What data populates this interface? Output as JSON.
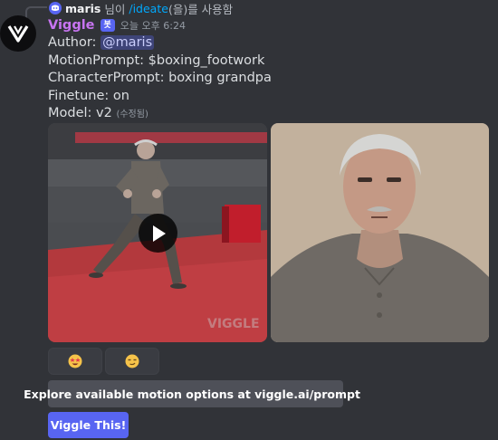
{
  "reply": {
    "username": "maris",
    "suffix_before": "님이",
    "command": "/ideate",
    "suffix_after": "(을)를 사용함"
  },
  "message": {
    "bot_name": "Viggle",
    "bot_badge": "봇",
    "timestamp": "오늘 오후 6:24",
    "author_label": "Author:",
    "author_mention": "@maris",
    "motion_prompt": "MotionPrompt: $boxing_footwork",
    "character_prompt": "CharacterPrompt: boxing grandpa",
    "finetune": "Finetune: on",
    "model": "Model: v2",
    "edited": "(수정됨)"
  },
  "media": {
    "video_watermark": "VIGGLE",
    "play_icon": "play-icon"
  },
  "reactions": [
    {
      "icon": "star-struck-emoji"
    },
    {
      "icon": "smirk-emoji"
    }
  ],
  "buttons": {
    "explore_label": "Explore available motion options at viggle.ai/prompt",
    "explore_icon": "external-link-icon",
    "viggle_this_label": "Viggle This!"
  },
  "colors": {
    "background": "#313338",
    "bot_name": "#c774f0",
    "blurple": "#5865f2",
    "link": "#00a8fc"
  }
}
